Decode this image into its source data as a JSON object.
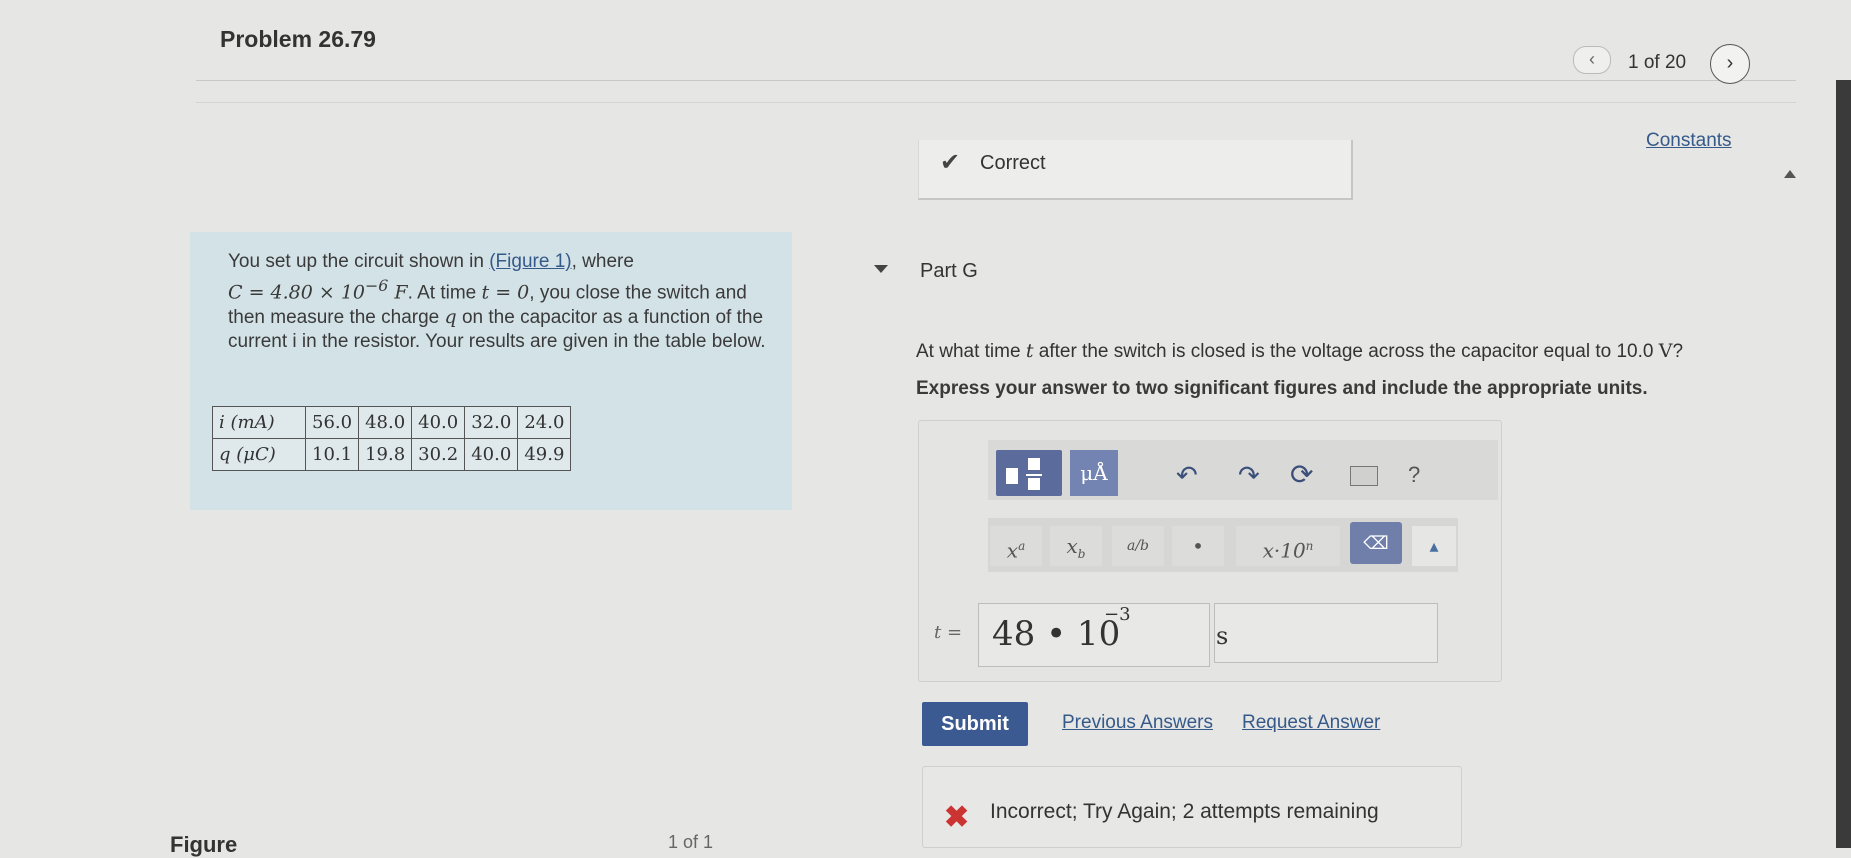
{
  "header": {
    "problem_title": "Problem 26.79",
    "prev_icon": "chevron-left",
    "page_indicator": "1 of 20",
    "next_icon": "chevron-right",
    "constants_link": "Constants"
  },
  "previous_part": {
    "status_icon": "checkmark",
    "status_text": "Correct"
  },
  "intro": {
    "text_1": "You set up the circuit shown in ",
    "figure_link": "(Figure 1)",
    "text_2": ", where",
    "capacitance_eq": "C = 4.80 × 10",
    "capacitance_exp": "−6",
    "capacitance_unit": " F",
    "text_3": ". At time ",
    "time_eq": "t = 0",
    "text_4": ", you close the switch and then measure the charge ",
    "charge_var": "q",
    "text_5": " on the capacitor as a function of the current i in the resistor. Your results are given in the table below."
  },
  "table": {
    "row_labels": [
      "i (mA)",
      "q (μC)"
    ],
    "current_values": [
      "56.0",
      "48.0",
      "40.0",
      "32.0",
      "24.0"
    ],
    "charge_values": [
      "10.1",
      "19.8",
      "30.2",
      "40.0",
      "49.9"
    ]
  },
  "part_g": {
    "title": "Part G",
    "question_1": "At what time ",
    "question_var": "t",
    "question_2": " after the switch is closed is the voltage across the capacitor equal to 10.0 ",
    "question_unit": "V",
    "question_3": "?",
    "instruction": "Express your answer to two significant figures and include the appropriate units."
  },
  "toolbar": {
    "units_label": "μÅ",
    "undo_icon": "undo-arrow",
    "redo_icon": "redo-arrow",
    "reset_icon": "reset-circle",
    "keyboard_icon": "keyboard",
    "help_label": "?",
    "superscript_label": "xa",
    "subscript_label": "xb",
    "fraction_label": "a/b",
    "dot_label": "•",
    "sci_label": "x·10n",
    "backspace_icon": "backspace",
    "keyboard2_icon": "keyboard-up"
  },
  "answer": {
    "variable_label": "t =",
    "value": "48 • 10",
    "exponent": "−3",
    "unit": "s"
  },
  "actions": {
    "submit": "Submit",
    "previous_answers": "Previous Answers",
    "request_answer": "Request Answer"
  },
  "feedback": {
    "icon": "x-mark",
    "text": "Incorrect; Try Again; 2 attempts remaining"
  },
  "figure": {
    "label": "Figure",
    "pager": "1 of 1"
  }
}
